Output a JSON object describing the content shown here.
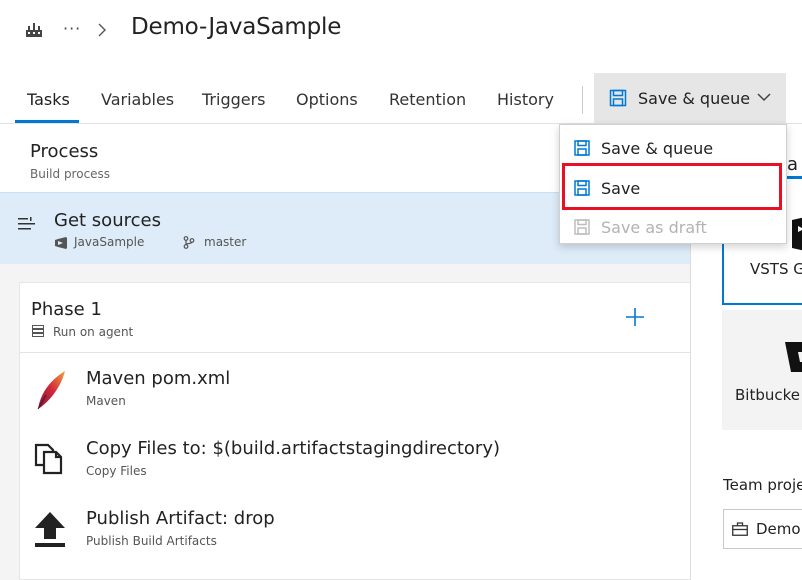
{
  "breadcrumb": {
    "more": "···",
    "title": "Demo-JavaSample"
  },
  "tabs": [
    {
      "label": "Tasks",
      "active": true
    },
    {
      "label": "Variables"
    },
    {
      "label": "Triggers"
    },
    {
      "label": "Options"
    },
    {
      "label": "Retention"
    },
    {
      "label": "History"
    }
  ],
  "toolbar": {
    "save_queue_label": "Save & queue"
  },
  "dropdown": {
    "items": [
      {
        "label": "Save & queue",
        "disabled": false
      },
      {
        "label": "Save",
        "disabled": false,
        "highlighted": true
      },
      {
        "label": "Save as draft",
        "disabled": true
      }
    ]
  },
  "process": {
    "title": "Process",
    "subtitle": "Build process"
  },
  "get_sources": {
    "title": "Get sources",
    "repo": "JavaSample",
    "branch": "master"
  },
  "phase": {
    "title": "Phase 1",
    "subtitle": "Run on agent"
  },
  "tasks": [
    {
      "title": "Maven pom.xml",
      "subtitle": "Maven",
      "icon": "maven-feather-icon"
    },
    {
      "title": "Copy Files to: $(build.artifactstagingdirectory)",
      "subtitle": "Copy Files",
      "icon": "copy-files-icon"
    },
    {
      "title": "Publish Artifact: drop",
      "subtitle": "Publish Build Artifacts",
      "icon": "upload-arrow-icon"
    }
  ],
  "right_pane": {
    "tab_fragment": "a",
    "source_cards": [
      {
        "label": "VSTS G",
        "selected": true
      },
      {
        "label": "Bitbucke"
      }
    ],
    "team_project_label": "Team proje",
    "team_project_value": "Demo"
  },
  "colors": {
    "accent": "#0078d4",
    "selected_row": "#deecf9",
    "highlight_border": "#e81123",
    "button_bg": "#e6e6e6"
  }
}
